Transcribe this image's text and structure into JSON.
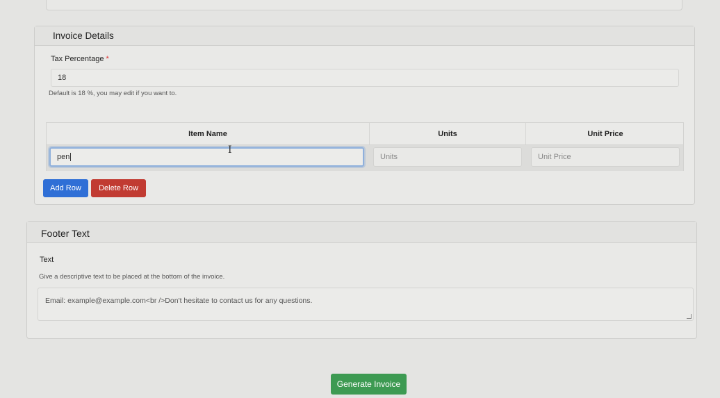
{
  "invoice_details": {
    "title": "Invoice Details",
    "tax_label": "Tax Percentage",
    "tax_required_mark": "*",
    "tax_value": "18",
    "tax_help": "Default is 18 %, you may edit if you want to."
  },
  "items_table": {
    "headers": [
      "Item Name",
      "Units",
      "Unit Price"
    ],
    "rows": [
      {
        "item_name": "pen",
        "units_placeholder": "Units",
        "unit_price_placeholder": "Unit Price"
      }
    ]
  },
  "actions": {
    "add_row": "Add Row",
    "delete_row": "Delete Row",
    "generate": "Generate Invoice"
  },
  "footer_text": {
    "title": "Footer Text",
    "label": "Text",
    "help": "Give a descriptive text to be placed at the bottom of the invoice.",
    "value": "Email: example@example.com<br />Don't hesitate to contact us for any questions."
  },
  "colors": {
    "primary": "#2f6fd6",
    "danger": "#c13b32",
    "success": "#3d9a52",
    "focus_ring": "#8fb0dc"
  },
  "icons": [
    "text-cursor-icon",
    "resize-handle-icon"
  ]
}
